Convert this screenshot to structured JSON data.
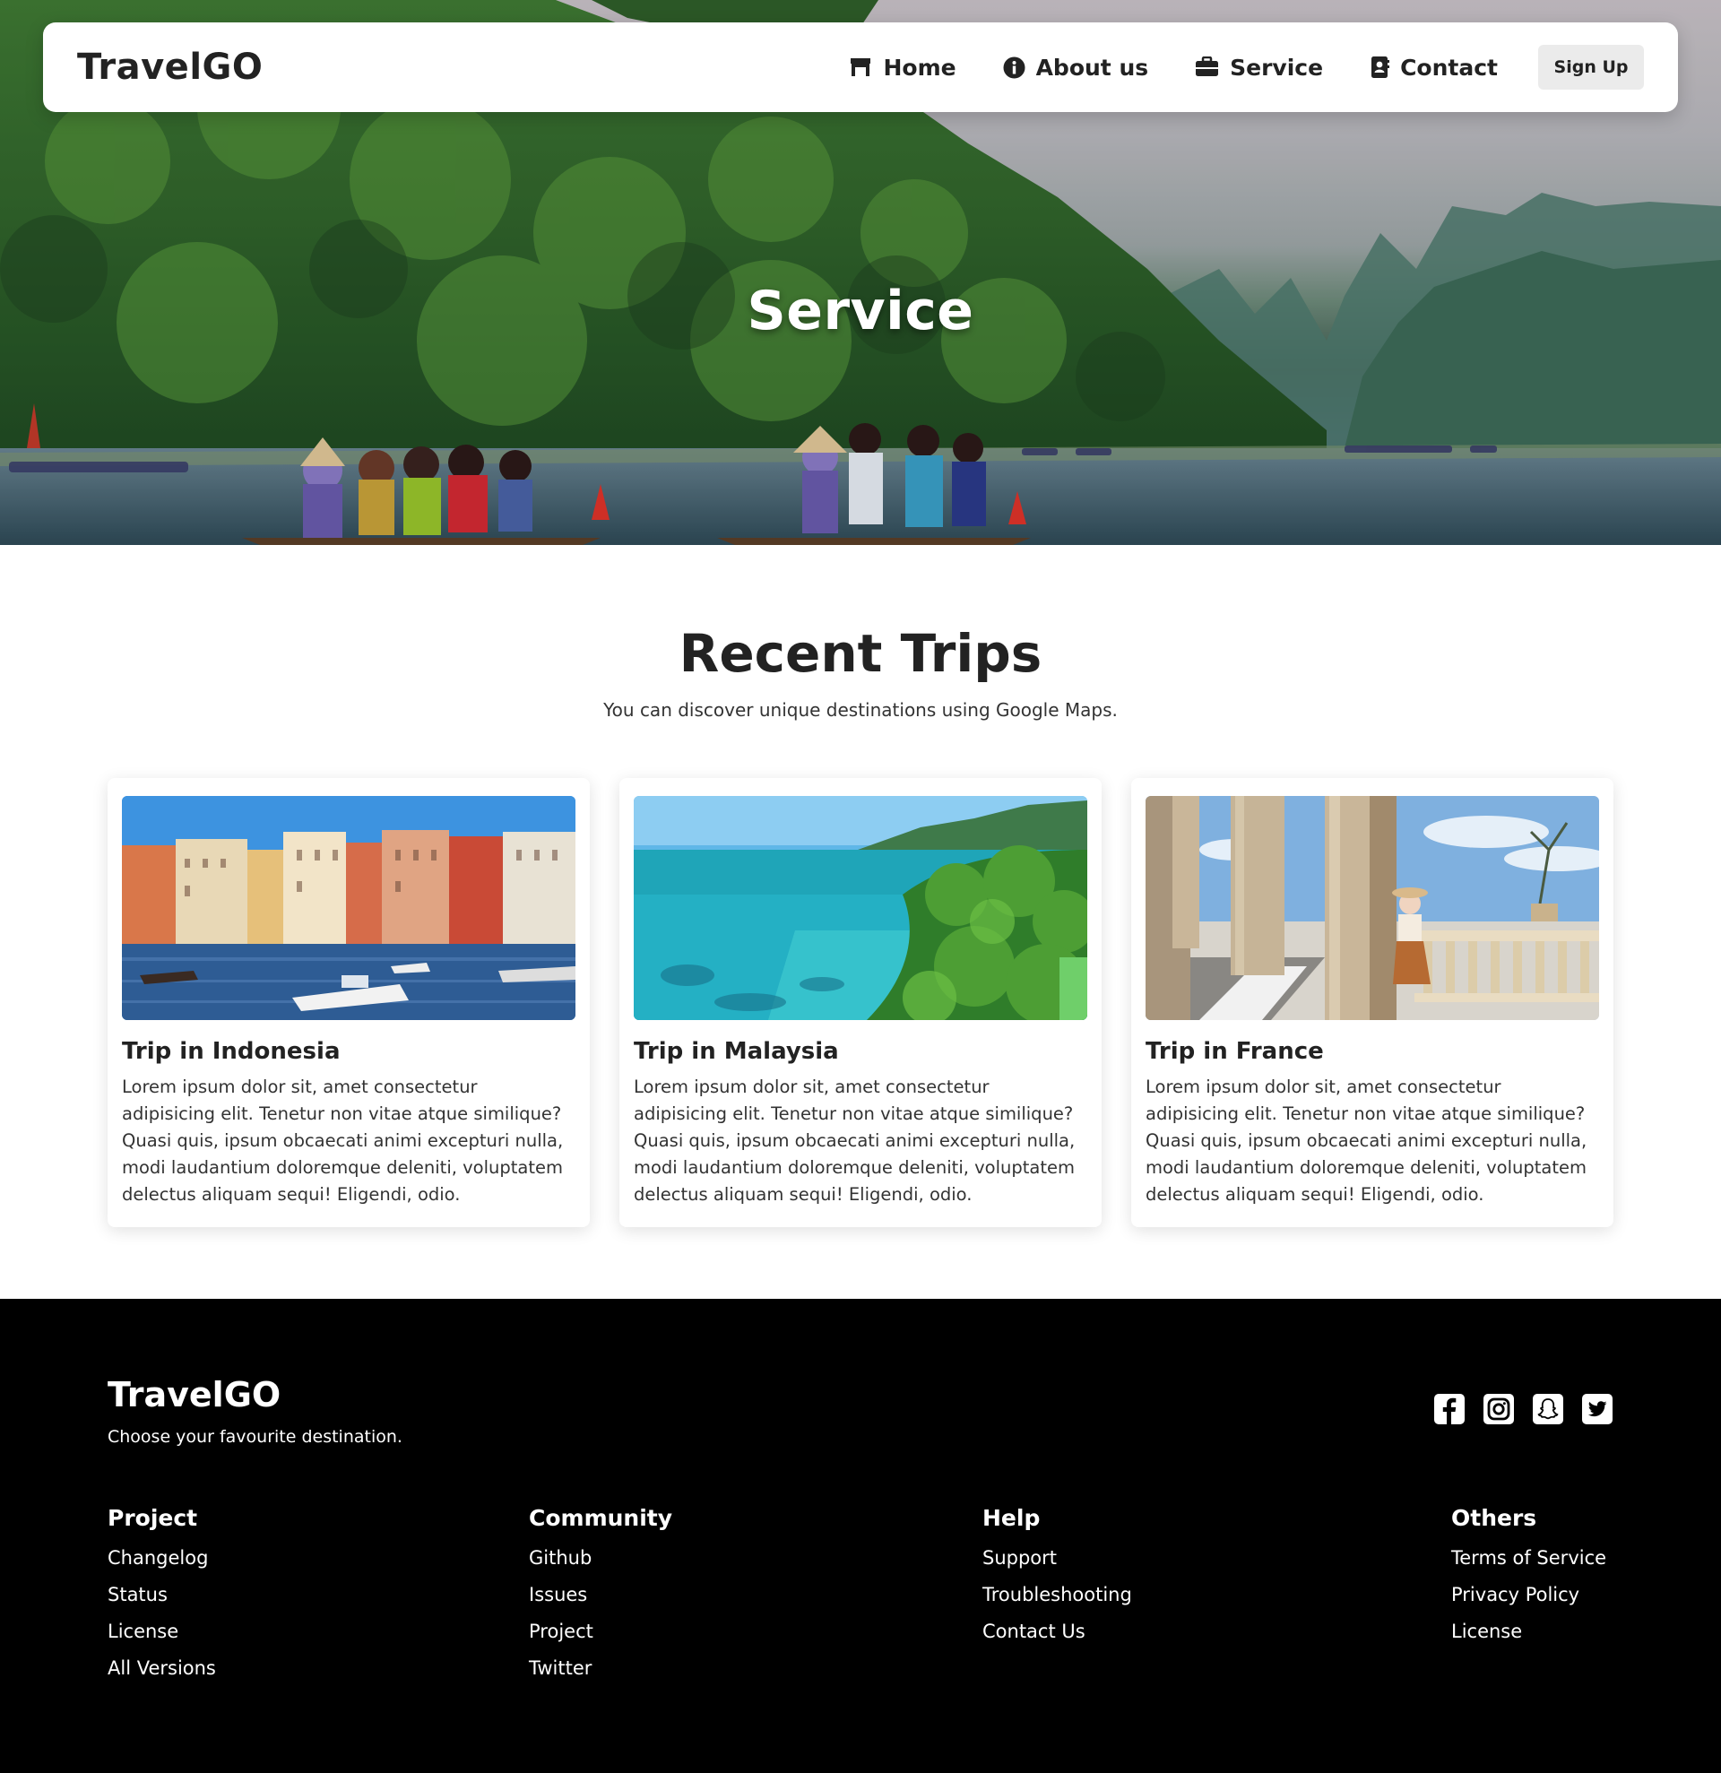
{
  "nav": {
    "brand": "TravelGO",
    "links": [
      {
        "label": "Home",
        "icon": "home-icon"
      },
      {
        "label": "About us",
        "icon": "info-icon"
      },
      {
        "label": "Service",
        "icon": "briefcase-icon"
      },
      {
        "label": "Contact",
        "icon": "contact-book-icon"
      }
    ],
    "signup_label": "Sign Up"
  },
  "hero": {
    "title": "Service"
  },
  "recent": {
    "title": "Recent Trips",
    "subtitle": "You can discover unique destinations using Google Maps.",
    "cards": [
      {
        "title": "Trip in Indonesia",
        "text": "Lorem ipsum dolor sit, amet consectetur adipisicing elit. Tenetur non vitae atque similique? Quasi quis, ipsum obcaecati animi excepturi nulla, modi laudantium doloremque deleniti, voluptatem delectus aliquam sequi! Eligendi, odio."
      },
      {
        "title": "Trip in Malaysia",
        "text": "Lorem ipsum dolor sit, amet consectetur adipisicing elit. Tenetur non vitae atque similique? Quasi quis, ipsum obcaecati animi excepturi nulla, modi laudantium doloremque deleniti, voluptatem delectus aliquam sequi! Eligendi, odio."
      },
      {
        "title": "Trip in France",
        "text": "Lorem ipsum dolor sit, amet consectetur adipisicing elit. Tenetur non vitae atque similique? Quasi quis, ipsum obcaecati animi excepturi nulla, modi laudantium doloremque deleniti, voluptatem delectus aliquam sequi! Eligendi, odio."
      }
    ]
  },
  "footer": {
    "brand": "TravelGO",
    "tagline": "Choose your favourite destination.",
    "socials": [
      "facebook-icon",
      "instagram-icon",
      "snapchat-icon",
      "twitter-icon"
    ],
    "columns": [
      {
        "title": "Project",
        "links": [
          "Changelog",
          "Status",
          "License",
          "All Versions"
        ]
      },
      {
        "title": "Community",
        "links": [
          "Github",
          "Issues",
          "Project",
          "Twitter"
        ]
      },
      {
        "title": "Help",
        "links": [
          "Support",
          "Troubleshooting",
          "Contact Us"
        ]
      },
      {
        "title": "Others",
        "links": [
          "Terms of Service",
          "Privacy Policy",
          "License"
        ]
      }
    ]
  },
  "colors": {
    "text": "#222222",
    "footer_bg": "#000000",
    "signup_bg": "#ebebeb"
  }
}
